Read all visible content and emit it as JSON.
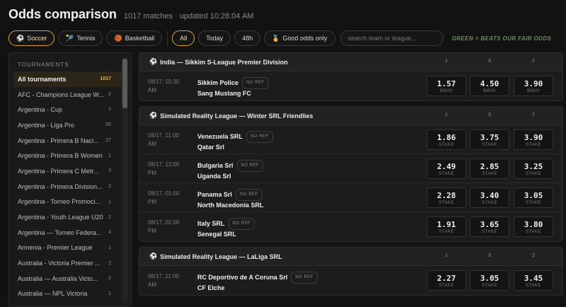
{
  "header": {
    "title": "Odds comparison",
    "subtitle": "1017 matches · updated 10:28:04 AM"
  },
  "sports": [
    {
      "label": "Soccer",
      "icon": "⚽",
      "active": true
    },
    {
      "label": "Tennis",
      "icon": "🎾",
      "active": false
    },
    {
      "label": "Basketball",
      "icon": "🏀",
      "active": false
    }
  ],
  "time_filters": {
    "all": "All",
    "today": "Today",
    "h48": "48h"
  },
  "good_odds": {
    "label": "Good odds only",
    "icon": "🏅"
  },
  "search": {
    "placeholder": "search team or league..."
  },
  "legend_note": "GREEN = BEATS OUR FAIR ODDS",
  "sidebar": {
    "heading": "TOURNAMENTS",
    "items": [
      {
        "name": "All tournaments",
        "count": "1017"
      },
      {
        "name": "AFC - Champions League W...",
        "count": "2"
      },
      {
        "name": "Argentina - Cup",
        "count": "7"
      },
      {
        "name": "Argentina - Liga Pro",
        "count": "50"
      },
      {
        "name": "Argentina - Primera B Naci...",
        "count": "27"
      },
      {
        "name": "Argentina - Primera B Women",
        "count": "1"
      },
      {
        "name": "Argentina - Primera C Metr...",
        "count": "3"
      },
      {
        "name": "Argentina - Primera Division...",
        "count": "2"
      },
      {
        "name": "Argentina - Torneo Promoci...",
        "count": "1"
      },
      {
        "name": "Argentina - Youth League U20",
        "count": "2"
      },
      {
        "name": "Argentina — Torneo Federa...",
        "count": "4"
      },
      {
        "name": "Armenia - Premier League",
        "count": "1"
      },
      {
        "name": "Australia - Victoria Premier ...",
        "count": "2"
      },
      {
        "name": "Australia — Australia Victo...",
        "count": "2"
      },
      {
        "name": "Australia — NPL Victoria",
        "count": "1"
      }
    ]
  },
  "columns": {
    "home": "1",
    "draw": "X",
    "away": "2"
  },
  "leagues": [
    {
      "name": "India — Sikkim S-League Premier Division",
      "matches": [
        {
          "date": "08/17, 10:30",
          "ampm": "AM",
          "home": "Sikkim Police",
          "away": "Sang Mustang FC",
          "badge": "NO REF",
          "odds": [
            "1.57",
            "4.50",
            "3.90"
          ],
          "book": "BWIN"
        }
      ]
    },
    {
      "name": "Simulated Reality League — Winter SRL Friendlies",
      "matches": [
        {
          "date": "08/17, 11:00",
          "ampm": "AM",
          "home": "Venezuela SRL",
          "away": "Qatar Srl",
          "badge": "NO REF",
          "odds": [
            "1.86",
            "3.75",
            "3.90"
          ],
          "book": "STAKE"
        },
        {
          "date": "08/17, 12:00",
          "ampm": "PM",
          "home": "Bulgaria Srl",
          "away": "Uganda Srl",
          "badge": "NO REF",
          "odds": [
            "2.49",
            "2.85",
            "3.25"
          ],
          "book": "STAKE"
        },
        {
          "date": "08/17, 01:00",
          "ampm": "PM",
          "home": "Panama Srl",
          "away": "North Macedonia SRL",
          "badge": "NO REF",
          "odds": [
            "2.28",
            "3.40",
            "3.05"
          ],
          "book": "STAKE"
        },
        {
          "date": "08/17, 02:00",
          "ampm": "PM",
          "home": "Italy SRL",
          "away": "Senegal SRL",
          "badge": "NO REF",
          "odds": [
            "1.91",
            "3.65",
            "3.80"
          ],
          "book": "STAKE"
        }
      ]
    },
    {
      "name": "Simulated Reality League — LaLiga SRL",
      "matches": [
        {
          "date": "08/17, 11:00",
          "ampm": "AM",
          "home": "RC Deportivo de A Coruna Srl",
          "away": "CF Elche",
          "badge": "NO REF",
          "odds": [
            "2.27",
            "3.05",
            "3.45"
          ],
          "book": "STAKE"
        }
      ]
    }
  ]
}
